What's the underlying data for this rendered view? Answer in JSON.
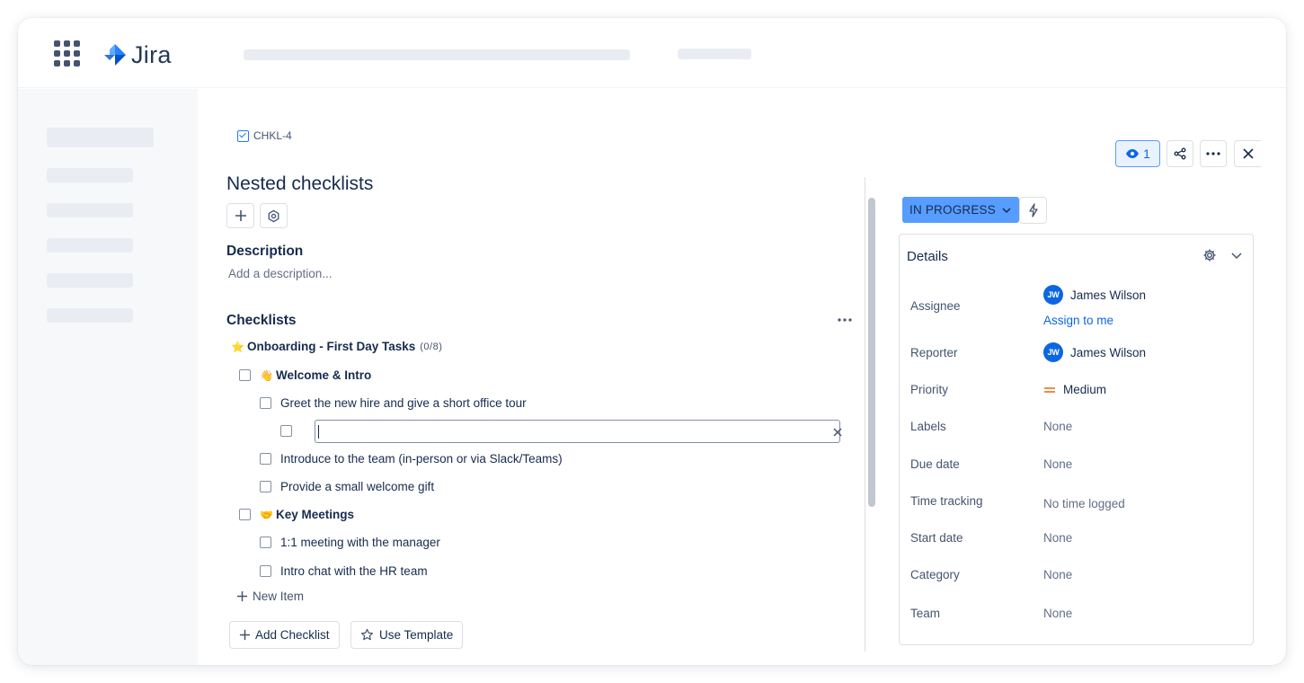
{
  "app": {
    "logo_text": "Jira"
  },
  "issue": {
    "key": "CHKL-4",
    "title": "Nested checklists",
    "description_heading": "Description",
    "description_placeholder": "Add a description..."
  },
  "checklists": {
    "heading": "Checklists",
    "list_title_emoji": "⭐",
    "list_title": "Onboarding - First Day Tasks",
    "list_count": "(0/8)",
    "groups": [
      {
        "emoji": "👋",
        "label": "Welcome & Intro",
        "items": [
          "Greet the new hire and give a short office tour",
          "",
          "Introduce to the team (in-person or via Slack/Teams)",
          "Provide a small welcome gift"
        ]
      },
      {
        "emoji": "🤝",
        "label": "Key Meetings",
        "items": [
          "1:1 meeting with the manager",
          "Intro chat with the HR team"
        ]
      }
    ],
    "new_item_label": "New Item",
    "add_checklist_label": "Add Checklist",
    "use_template_label": "Use Template"
  },
  "header_actions": {
    "watch_count": "1"
  },
  "status": {
    "label": "IN PROGRESS"
  },
  "details": {
    "title": "Details",
    "assignee_label": "Assignee",
    "assignee_initials": "JW",
    "assignee_name": "James Wilson",
    "assign_to_me": "Assign to me",
    "reporter_label": "Reporter",
    "reporter_initials": "JW",
    "reporter_name": "James Wilson",
    "priority_label": "Priority",
    "priority_value": "Medium",
    "priority_color": "#E56910",
    "labels_label": "Labels",
    "labels_value": "None",
    "due_date_label": "Due date",
    "due_date_value": "None",
    "time_tracking_label": "Time tracking",
    "time_tracking_value": "No time logged",
    "start_date_label": "Start date",
    "start_date_value": "None",
    "category_label": "Category",
    "category_value": "None",
    "team_label": "Team",
    "team_value": "None"
  },
  "colors": {
    "accent": "#0C66E4",
    "status_bg": "#579DFF",
    "skeleton": "#E9EDF3"
  }
}
